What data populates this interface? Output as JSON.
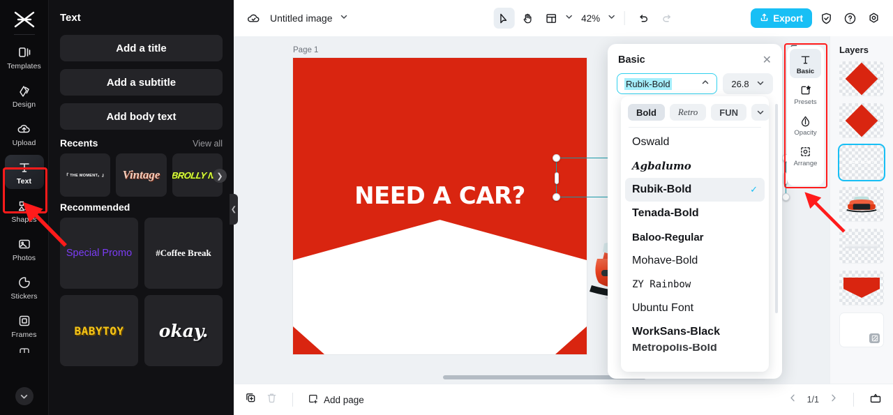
{
  "rail": {
    "logo_icon": "capcut-logo-icon",
    "items": [
      {
        "label": "Templates",
        "icon": "templates-icon"
      },
      {
        "label": "Design",
        "icon": "design-icon"
      },
      {
        "label": "Upload",
        "icon": "upload-cloud-icon"
      },
      {
        "label": "Text",
        "icon": "text-t-icon",
        "active": true
      },
      {
        "label": "Shapes",
        "icon": "shapes-icon"
      },
      {
        "label": "Photos",
        "icon": "photos-image-icon"
      },
      {
        "label": "Stickers",
        "icon": "stickers-icon"
      },
      {
        "label": "Frames",
        "icon": "frames-icon"
      }
    ],
    "more_icon": "chevron-down-icon",
    "highlight_color": "#ff1b1b"
  },
  "panel": {
    "title": "Text",
    "buttons": [
      {
        "label": "Add a title"
      },
      {
        "label": "Add a subtitle"
      },
      {
        "label": "Add body text"
      }
    ],
    "recents": {
      "title": "Recents",
      "view_all": "View all",
      "items": [
        {
          "label": "『 THE MOMENT。』"
        },
        {
          "label": "Vintage"
        },
        {
          "label": "BROLLY NO."
        }
      ],
      "next_icon": "chevron-right-icon"
    },
    "recommended": {
      "title": "Recommended",
      "items": [
        {
          "label": "Special Promo"
        },
        {
          "label": "#Coffee Break"
        },
        {
          "label": "BABYTOY"
        },
        {
          "label": "okay."
        }
      ]
    },
    "collapse_icon": "chevron-left-icon"
  },
  "topbar": {
    "cloud_icon": "cloud-check-icon",
    "doc_title": "Untitled image",
    "title_caret_icon": "chevron-down-icon",
    "tools": [
      {
        "name": "select-tool",
        "icon": "cursor-arrow-icon",
        "selected": true
      },
      {
        "name": "hand-tool",
        "icon": "hand-icon",
        "selected": false
      },
      {
        "name": "layout-tool",
        "icon": "layout-panel-icon",
        "selected": false
      }
    ],
    "layout_caret_icon": "chevron-down-icon",
    "zoom": "42%",
    "zoom_caret_icon": "chevron-down-icon",
    "undo_icon": "undo-arrow-icon",
    "redo_icon": "redo-arrow-icon",
    "export_label": "Export",
    "export_icon": "export-upload-icon",
    "export_color": "#18bff5",
    "shield_icon": "shield-check-icon",
    "help_icon": "question-circle-icon",
    "settings_icon": "gear-icon"
  },
  "canvas": {
    "page_label": "Page 1",
    "duplicate_icon": "duplicate-page-icon",
    "more_icon": "more-dots-icon",
    "background_color": "#d92510",
    "headline": "NEED A CAR?",
    "float_toolbar": {
      "duplicate_icon": "duplicate-layer-icon",
      "more_icon": "more-dots-icon"
    },
    "rotate_icon": "rotate-handle-icon",
    "selection_color": "#1a9aa8"
  },
  "bottombar": {
    "duplicate_icon": "duplicate-page-icon",
    "delete_icon": "trash-icon",
    "add_page_label": "Add page",
    "add_page_icon": "add-page-icon",
    "prev_icon": "chevron-left-icon",
    "page_indicator": "1/1",
    "next_icon": "chevron-right-icon",
    "present_icon": "present-icon"
  },
  "fontpanel": {
    "title": "Basic",
    "close_icon": "close-icon",
    "font_value": "Rubik-Bold",
    "font_caret_icon": "chevron-up-icon",
    "size_value": "26.8",
    "size_caret_icon": "chevron-down-icon",
    "highlight_color": "#2fd0ee",
    "chips": [
      {
        "label": "Bold",
        "active": true
      },
      {
        "label": "Retro",
        "active": false
      },
      {
        "label": "FUN",
        "active": false
      }
    ],
    "chips_more_icon": "chevron-down-icon",
    "fonts": [
      {
        "name": "Oswald",
        "selected": false
      },
      {
        "name": "Agbalumo",
        "selected": false
      },
      {
        "name": "Rubik-Bold",
        "selected": true
      },
      {
        "name": "Tenada-Bold",
        "selected": false
      },
      {
        "name": "Baloo-Regular",
        "selected": false
      },
      {
        "name": "Mohave-Bold",
        "selected": false
      },
      {
        "name": "ZY Rainbow",
        "selected": false
      },
      {
        "name": "Ubuntu Font",
        "selected": false
      },
      {
        "name": "WorkSans-Black",
        "selected": false
      },
      {
        "name": "Metropolis-Bold",
        "selected": false
      }
    ],
    "check_icon": "check-icon"
  },
  "toolrail": {
    "highlight_color": "#ff1b1b",
    "items": [
      {
        "label": "Basic",
        "icon": "text-t-icon",
        "active": true
      },
      {
        "label": "Presets",
        "icon": "presets-star-icon",
        "active": false
      },
      {
        "label": "Opacity",
        "icon": "opacity-drop-icon",
        "active": false
      },
      {
        "label": "Arrange",
        "icon": "arrange-icon",
        "active": false
      }
    ]
  },
  "layers": {
    "title": "Layers",
    "items": [
      {
        "kind": "diamond-shape",
        "selected": false
      },
      {
        "kind": "diamond-shape",
        "selected": false
      },
      {
        "kind": "text-layer",
        "label": "NEED A CAR?",
        "selected": true
      },
      {
        "kind": "car-image",
        "selected": false
      },
      {
        "kind": "line-shape",
        "selected": false
      },
      {
        "kind": "pentagon-shape",
        "selected": false
      },
      {
        "kind": "background-layer",
        "selected": false
      }
    ]
  },
  "annotations": {
    "arrow_color": "#ff1b1b",
    "arrows": [
      {
        "name": "arrow-pointing-text-tool"
      },
      {
        "name": "arrow-pointing-tool-rail"
      }
    ]
  }
}
